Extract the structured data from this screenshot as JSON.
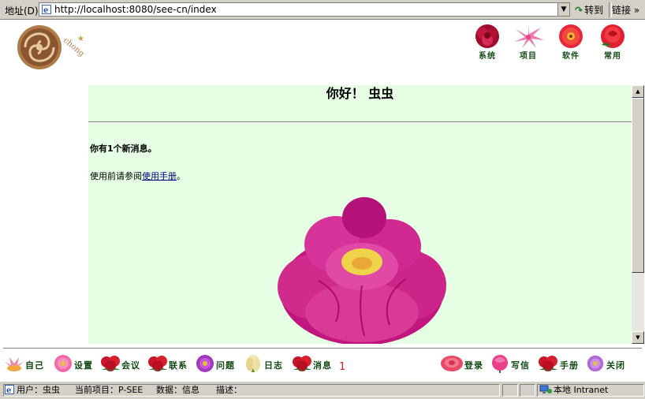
{
  "toolbar": {
    "address_label": "地址(D)",
    "url": "http://localhost:8080/see-cn/index",
    "go_label": "转到",
    "links_label": "链接"
  },
  "top_nav": [
    {
      "label": "系统",
      "icon": "peony-dark-red-icon"
    },
    {
      "label": "项目",
      "icon": "lily-pink-icon"
    },
    {
      "label": "软件",
      "icon": "gerbera-red-icon"
    },
    {
      "label": "常用",
      "icon": "rose-red-icon"
    }
  ],
  "content": {
    "greeting": "你好！ 虫虫",
    "new_message": "你有1个新消息。",
    "manual_prefix": "使用前请参阅",
    "manual_link": "使用手册",
    "manual_suffix": "。"
  },
  "bottom_nav_left": [
    {
      "label": "自己",
      "icon": "lotus-icon"
    },
    {
      "label": "设置",
      "icon": "aster-pink-icon"
    },
    {
      "label": "会议",
      "icon": "rose-bouquet-icon"
    },
    {
      "label": "联系",
      "icon": "rose-bouquet-icon"
    },
    {
      "label": "问题",
      "icon": "aster-purple-icon"
    },
    {
      "label": "日志",
      "icon": "magnolia-icon"
    },
    {
      "label": "消息",
      "icon": "rose-bouquet-icon"
    }
  ],
  "message_count": "1",
  "bottom_nav_right": [
    {
      "label": "登录",
      "icon": "carnation-icon"
    },
    {
      "label": "写信",
      "icon": "tulip-icon"
    },
    {
      "label": "手册",
      "icon": "rose-bouquet-icon"
    },
    {
      "label": "关闭",
      "icon": "aster-purple-icon"
    }
  ],
  "status": {
    "user": "用户：虫虫",
    "project": "当前项目：P-SEE",
    "data": "数据：信息",
    "desc": "描述：",
    "zone": "本地 Intranet"
  },
  "colors": {
    "content_bg": "#e6ffe4",
    "nav_label": "#104a10",
    "chrome": "#d4d0c8",
    "link": "#000080"
  }
}
